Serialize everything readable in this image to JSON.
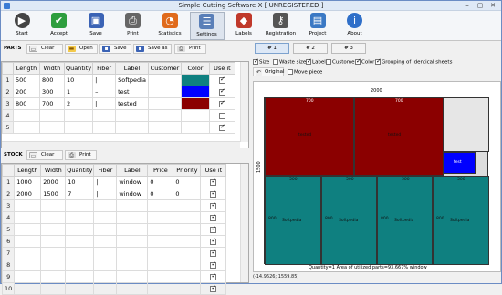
{
  "window": {
    "title": "Simple Cutting Software X [ UNREGISTERED ]",
    "min": "–",
    "max": "▢",
    "close": "✕"
  },
  "toolbar": [
    {
      "label": "Start",
      "icon": "start-icon",
      "glyph": "▶",
      "color": "#444444"
    },
    {
      "label": "Accept",
      "icon": "accept-icon",
      "glyph": "✔",
      "color": "#2e9e3e"
    },
    {
      "label": "Save",
      "icon": "save-icon",
      "glyph": "▣",
      "color": "#3b63b5"
    },
    {
      "label": "Print",
      "icon": "print-icon",
      "glyph": "⎙",
      "color": "#666666"
    },
    {
      "label": "Statistics",
      "icon": "statistics-icon",
      "glyph": "◔",
      "color": "#e06a1b"
    },
    {
      "label": "Settings",
      "icon": "settings-icon",
      "glyph": "☰",
      "color": "#5a7fb8"
    },
    {
      "label": "Labels",
      "icon": "labels-icon",
      "glyph": "◆",
      "color": "#c0392b"
    },
    {
      "label": "Registration",
      "icon": "registration-icon",
      "glyph": "⚷",
      "color": "#555555"
    },
    {
      "label": "Project",
      "icon": "project-icon",
      "glyph": "▤",
      "color": "#3a78c4"
    },
    {
      "label": "About",
      "icon": "about-icon",
      "glyph": "i",
      "color": "#2f6fc9"
    }
  ],
  "parts": {
    "label": "PARTS",
    "buttons": {
      "clear": "Clear",
      "open": "Open",
      "save": "Save",
      "save_as": "Save as",
      "print": "Print"
    },
    "columns": [
      "",
      "Length",
      "Width",
      "Quantity",
      "Fiber",
      "Label",
      "Customer",
      "Color",
      "Use it"
    ],
    "rows": [
      {
        "n": "1",
        "length": "500",
        "width": "800",
        "qty": "10",
        "fiber": "|",
        "label": "Softpedia",
        "customer": "",
        "color": "#0f8080",
        "use": true
      },
      {
        "n": "2",
        "length": "200",
        "width": "300",
        "qty": "1",
        "fiber": "–",
        "label": "test",
        "customer": "",
        "color": "#0000ff",
        "use": true
      },
      {
        "n": "3",
        "length": "800",
        "width": "700",
        "qty": "2",
        "fiber": "|",
        "label": "tested",
        "customer": "",
        "color": "#8b0000",
        "use": true
      },
      {
        "n": "4",
        "length": "",
        "width": "",
        "qty": "",
        "fiber": "",
        "label": "",
        "customer": "",
        "color": "",
        "use": false
      },
      {
        "n": "5",
        "length": "",
        "width": "",
        "qty": "",
        "fiber": "",
        "label": "",
        "customer": "",
        "color": "",
        "use": true
      }
    ]
  },
  "stock": {
    "label": "STOCK",
    "buttons": {
      "clear": "Clear",
      "print": "Print"
    },
    "columns": [
      "",
      "Length",
      "Width",
      "Quantity",
      "Fiber",
      "Label",
      "Price",
      "Priority",
      "Use it"
    ],
    "rows": [
      {
        "n": "1",
        "length": "1000",
        "width": "2000",
        "qty": "10",
        "fiber": "|",
        "label": "window",
        "price": "0",
        "priority": "0",
        "use": true
      },
      {
        "n": "2",
        "length": "2000",
        "width": "1500",
        "qty": "7",
        "fiber": "|",
        "label": "window",
        "price": "0",
        "priority": "0",
        "use": true
      },
      {
        "n": "3",
        "use": true
      },
      {
        "n": "4",
        "use": true
      },
      {
        "n": "5",
        "use": true
      },
      {
        "n": "6",
        "use": true
      },
      {
        "n": "7",
        "use": true
      },
      {
        "n": "8",
        "use": true
      },
      {
        "n": "9",
        "use": true
      },
      {
        "n": "10",
        "use": true
      }
    ]
  },
  "tabs": [
    "# 1",
    "# 2",
    "# 3"
  ],
  "options": {
    "size": "Size",
    "waste_size": "Waste size",
    "label": "Label",
    "customer": "Customer",
    "color": "Color",
    "grouping": "Grouping of identical sheets",
    "original": "Original",
    "move_piece": "Move piece"
  },
  "layout": {
    "sheet_width": "2000",
    "sheet_height": "1500",
    "top_dims": [
      "700",
      "700"
    ],
    "piece_labels_top": [
      "tested",
      "tested"
    ],
    "bottom_dims": [
      "500",
      "500",
      "500",
      "500"
    ],
    "bottom_side": "800",
    "piece_labels_bottom": [
      "Softpedia",
      "Softpedia",
      "Softpedia",
      "Softpedia"
    ],
    "small_piece": "test",
    "summary": "Quantity=1 Area of utilized parts=93.667% window",
    "coords": "(-14.9626; 1559.85)"
  }
}
